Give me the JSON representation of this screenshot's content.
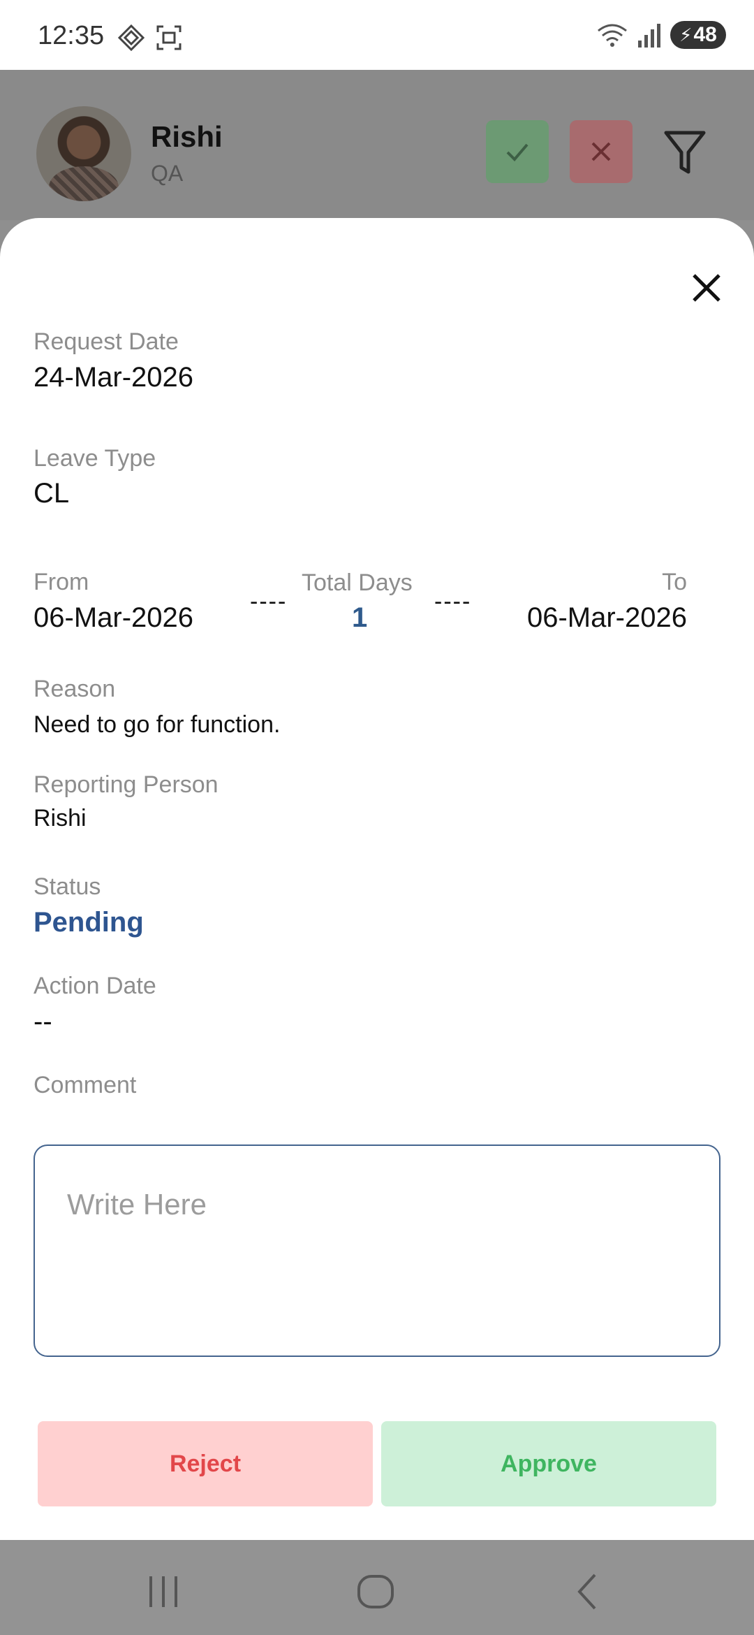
{
  "status_bar": {
    "time": "12:35",
    "battery": "48",
    "icons": [
      "nfc-icon",
      "screenshot-icon",
      "wifi-icon",
      "signal-icon",
      "battery-icon"
    ]
  },
  "header": {
    "name": "Rishi",
    "role": "QA",
    "approve_icon": "check-icon",
    "reject_icon": "close-icon",
    "filter_icon": "filter-icon"
  },
  "detail": {
    "request_date_label": "Request Date",
    "request_date": "24-Mar-2026",
    "leave_type_label": "Leave Type",
    "leave_type": "CL",
    "from_label": "From",
    "from": "06-Mar-2026",
    "total_days_label": "Total Days",
    "total_days": "1",
    "to_label": "To",
    "to": "06-Mar-2026",
    "separator": "----",
    "reason_label": "Reason",
    "reason": "Need to go for function.",
    "reporting_person_label": "Reporting Person",
    "reporting_person": "Rishi",
    "status_label": "Status",
    "status": "Pending",
    "action_date_label": "Action Date",
    "action_date": "--",
    "comment_label": "Comment",
    "comment_placeholder": "Write Here",
    "comment_value": ""
  },
  "actions": {
    "reject_label": "Reject",
    "approve_label": "Approve"
  },
  "colors": {
    "status": "#2e5590",
    "total_days": "#2f5a8c",
    "reject_bg": "#ffd0d0",
    "reject_text": "#e2474a",
    "approve_bg": "#cdf0d8",
    "approve_text": "#3fb560"
  }
}
